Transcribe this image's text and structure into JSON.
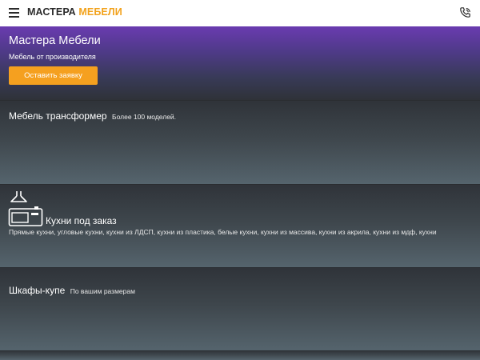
{
  "header": {
    "logo_main": "МАСТЕРА",
    "logo_accent": "МЕБЕЛИ",
    "menu_icon": "hamburger-menu-icon",
    "phone_icon": "phone-icon"
  },
  "hero": {
    "title": "Мастера Мебели",
    "subtitle": "Мебель от производителя",
    "cta_label": "Оставить заявку"
  },
  "sections": [
    {
      "title": "Мебель трансформер",
      "description": "Более 100 моделей."
    },
    {
      "title": "Кухни под заказ",
      "description": "Прямые кухни, угловые кухни, кухни из ЛДСП, кухни из пластика, белые кухни, кухни из массива, кухни из акрила, кухни из мдф, кухни",
      "icon": "kitchen-stove-icon"
    },
    {
      "title": "Шкафы-купе",
      "description": "По вашим размерам"
    }
  ],
  "colors": {
    "accent": "#f5a01f",
    "hero_top": "#6a3bb0",
    "text": "#ffffff"
  }
}
